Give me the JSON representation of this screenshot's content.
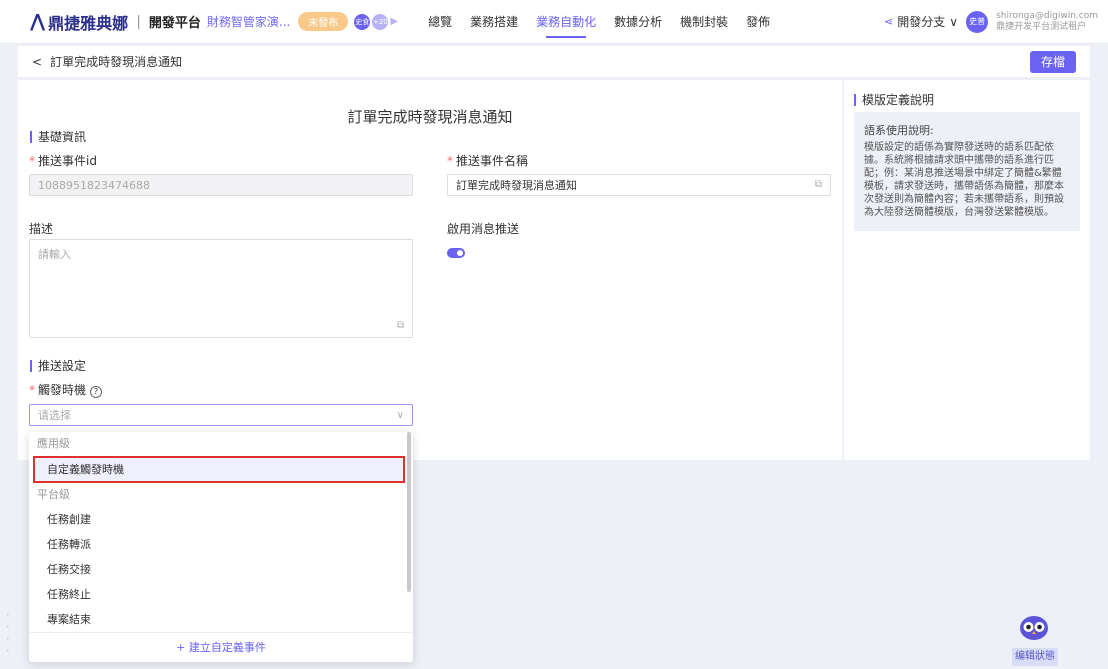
{
  "topbar": {
    "logo_text": "鼎捷雅典娜",
    "platform": "開發平台",
    "app_name": "財務智管家演...",
    "status_pill": "未發布",
    "badge1": "史食",
    "badge2": "+20",
    "nav": [
      "總覽",
      "業務搭建",
      "業務自動化",
      "數據分析",
      "機制封裝",
      "發佈"
    ],
    "active_nav": "業務自動化",
    "branch_label": "開發分支",
    "avatar_text": "史普",
    "user_email": "shironga@digiwin.com",
    "user_tenant": "鼎捷开发平台测试租户"
  },
  "subheader": {
    "back_glyph": "<",
    "title": "訂單完成時發現消息通知",
    "save_label": "存檔"
  },
  "form": {
    "title": "訂單完成時發現消息通知",
    "section_basic": "基礎資訊",
    "event_id_label": "推送事件id",
    "event_id_value": "1088951823474688",
    "event_name_label": "推送事件名稱",
    "event_name_value": "訂單完成時發現消息通知",
    "desc_label": "描述",
    "desc_placeholder": "請輸入",
    "enable_label": "啟用消息推送",
    "enable_on": true,
    "section_push": "推送設定",
    "trigger_label": "觸發時機",
    "trigger_placeholder": "请选择"
  },
  "right_panel": {
    "title": "模版定義說明",
    "note_title": "語系使用說明:",
    "note_body": "模版設定的語係為實際發送時的語系匹配依據。系統將根據請求頭中攜帶的語系進行匹配；例：某消息推送場景中綁定了簡體&繁體模板，請求發送時，攜帶語係為簡體，那麼本次發送則為簡體內容；若未攜帶語系，則預設為大陸發送簡體模版，台灣發送繁體模版。"
  },
  "dropdown": {
    "groups": [
      {
        "label": "應用級",
        "items": [
          "自定義觸發時機"
        ]
      },
      {
        "label": "平台級",
        "items": [
          "任務創建",
          "任務轉派",
          "任務交接",
          "任務終止",
          "專案結束"
        ]
      }
    ],
    "selected": "自定義觸發時機",
    "footer": "+ 建立自定義事件"
  },
  "status_label": "编辑狀態",
  "colors": {
    "accent": "#6a62f2",
    "highlight": "#e0302b",
    "pill": "#f9c98a"
  }
}
